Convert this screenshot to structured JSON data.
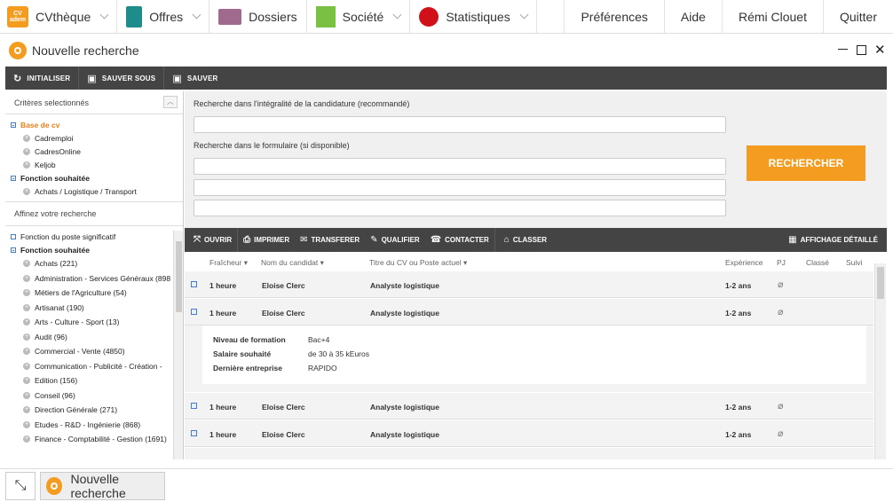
{
  "nav": {
    "logo_text": "CV\nadem",
    "cvtheque": "CVthèque",
    "offres": "Offres",
    "dossiers": "Dossiers",
    "societe": "Société",
    "statistiques": "Statistiques",
    "preferences": "Préférences",
    "aide": "Aide",
    "user": "Rémi Clouet",
    "quitter": "Quitter"
  },
  "window": {
    "title": "Nouvelle recherche"
  },
  "toolbar": {
    "initialiser": "INITIALISER",
    "sauver_sous": "SAUVER SOUS",
    "sauver": "SAUVER"
  },
  "criteria": {
    "header": "Critères selectionnés",
    "base_label": "Base de cv",
    "bases": [
      "Cadremploi",
      "CadresOnline",
      "Keljob"
    ],
    "fonction_label": "Fonction souhaitée",
    "fonctions": [
      "Achats / Logistique / Transport"
    ]
  },
  "refine": {
    "header": "Affinez votre recherche",
    "fonction_poste": "Fonction du poste significatif",
    "fonction_souhaitee": "Fonction souhaitée",
    "items": [
      "Achats (221)",
      "Administration - Services Généraux (898",
      "Métiers de l'Agriculture (54)",
      "Artisanat (190)",
      "Arts - Culture - Sport (13)",
      "Audit (96)",
      "Commercial - Vente (4850)",
      "Communication - Publicité - Création -",
      "Edition (156)",
      "Conseil (96)",
      "Direction Générale (271)",
      "Etudes - R&D - Ingénierie (868)",
      "Finance - Comptabilité - Gestion (1691)"
    ]
  },
  "search": {
    "label_full": "Recherche dans l'intégralité de la candidature (recommandé)",
    "label_form": "Recherche dans le formulaire (si disponible)",
    "button": "RECHERCHER"
  },
  "results_toolbar": {
    "ouvrir": "OUVRIR",
    "imprimer": "IMPRIMER",
    "transferer": "TRANSFERER",
    "qualifier": "QUALIFIER",
    "contacter": "CONTACTER",
    "classer": "CLASSER",
    "affichage": "AFFICHAGE DÉTAILLÉ"
  },
  "columns": {
    "fraicheur": "Fraîcheur",
    "nom": "Nom du candidat",
    "titre": "Titre du CV ou Poste actuel",
    "experience": "Expérience",
    "pj": "PJ",
    "classe": "Classé",
    "suivi": "Suivi"
  },
  "rows": [
    {
      "fraicheur": "1 heure",
      "nom": "Eloise Clerc",
      "titre": "Analyste logistique",
      "experience": "1-2 ans"
    },
    {
      "fraicheur": "1 heure",
      "nom": "Eloise Clerc",
      "titre": "Analyste logistique",
      "experience": "1-2 ans"
    },
    {
      "fraicheur": "1 heure",
      "nom": "Eloise Clerc",
      "titre": "Analyste logistique",
      "experience": "1-2 ans"
    },
    {
      "fraicheur": "1 heure",
      "nom": "Eloise Clerc",
      "titre": "Analyste logistique",
      "experience": "1-2 ans"
    }
  ],
  "detail": {
    "niveau_label": "Niveau de formation",
    "niveau_value": "Bac+4",
    "salaire_label": "Salaire souhaité",
    "salaire_value": "de 30 à 35 kEuros",
    "entreprise_label": "Dernière entreprise",
    "entreprise_value": "RAPIDO"
  },
  "taskbar": {
    "tab_label": "Nouvelle recherche"
  },
  "colors": {
    "accent": "#f39c1f",
    "toolbar": "#444444",
    "tree_link": "#4a7bc7"
  }
}
